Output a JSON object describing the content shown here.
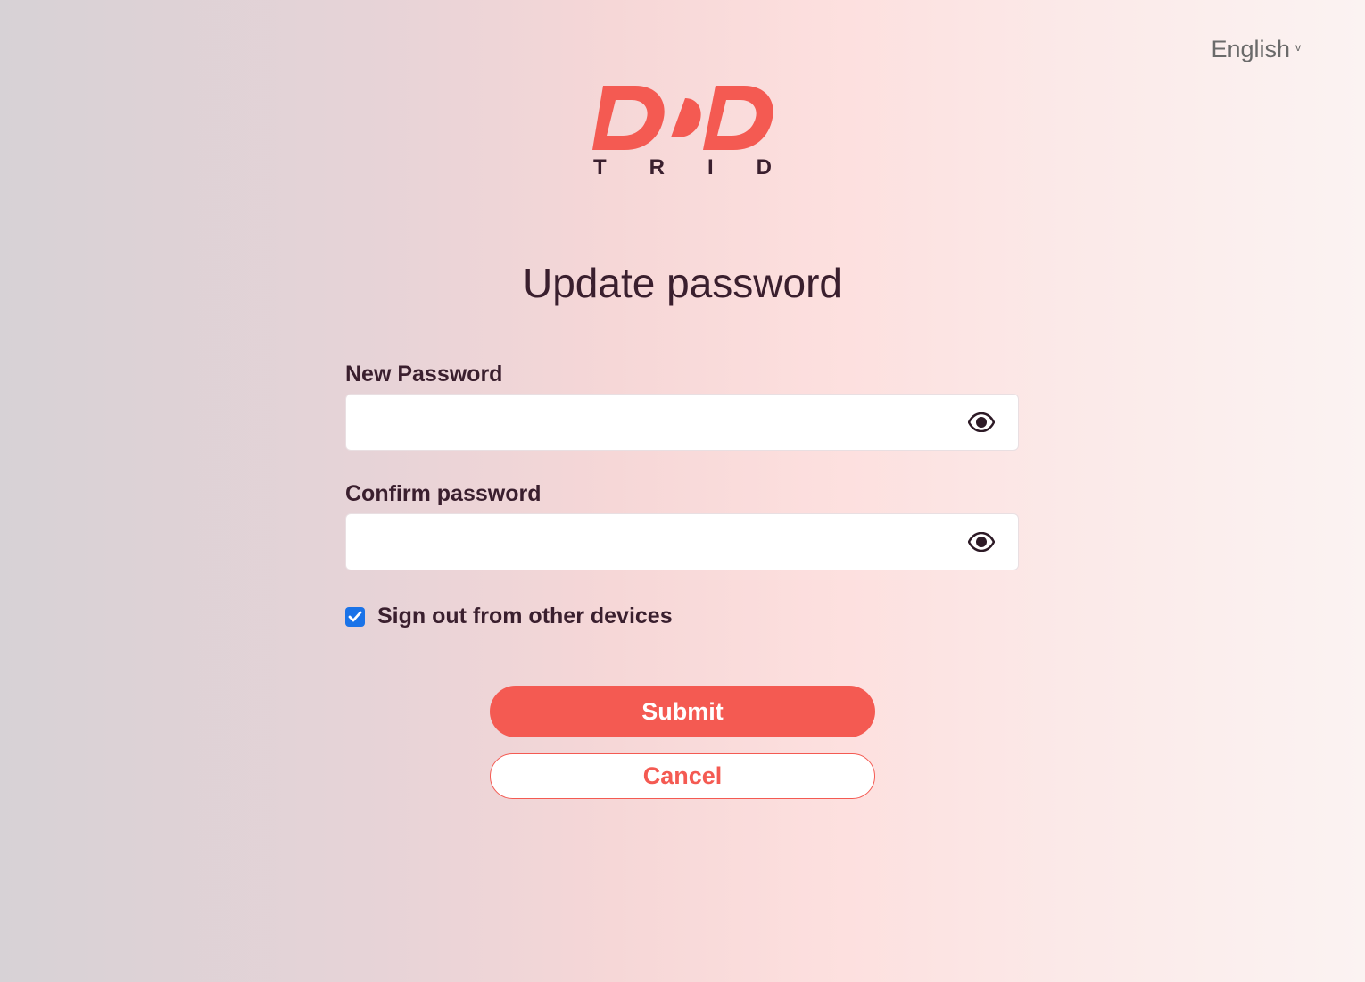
{
  "language": {
    "label": "English",
    "chevron": "v"
  },
  "logo": {
    "mark": "DD",
    "letters": [
      "T",
      "R",
      "I",
      "D"
    ],
    "color": "#f45a52"
  },
  "page": {
    "title": "Update password"
  },
  "form": {
    "new_password": {
      "label": "New Password",
      "value": "",
      "placeholder": "",
      "icon": "eye-icon"
    },
    "confirm_password": {
      "label": "Confirm password",
      "value": "",
      "placeholder": "",
      "icon": "eye-icon"
    },
    "sign_out": {
      "label": "Sign out from other devices",
      "checked": true
    }
  },
  "buttons": {
    "submit": "Submit",
    "cancel": "Cancel"
  },
  "colors": {
    "accent": "#f45a52",
    "text": "#3a1f2e",
    "checkbox": "#1a73e8"
  }
}
